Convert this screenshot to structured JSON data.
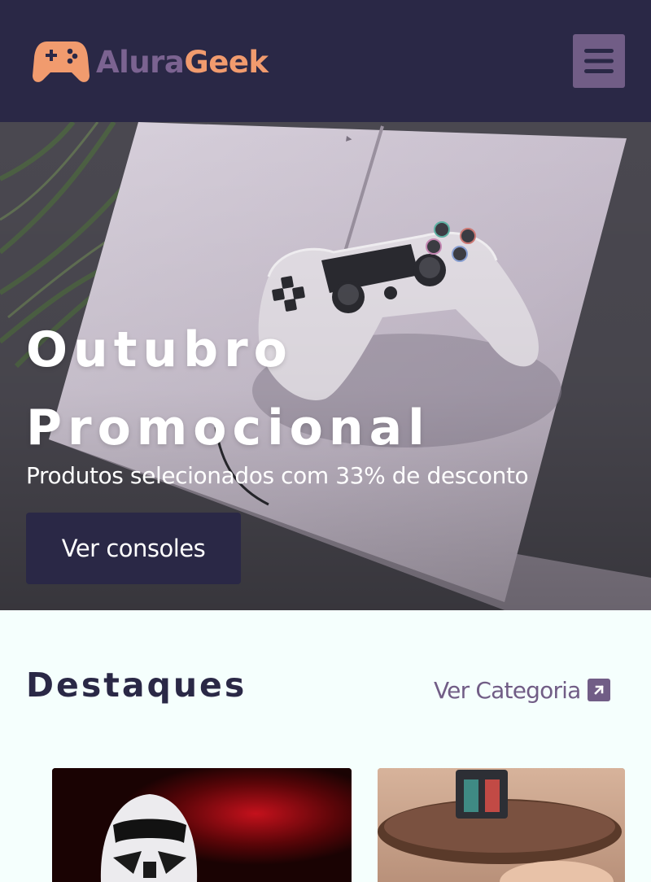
{
  "header": {
    "logo": {
      "part1": "Alura",
      "part2": "Geek"
    },
    "menu_icon": "hamburger-icon"
  },
  "hero": {
    "title_line1": "Outubro",
    "title_line2": "Promocional",
    "subtitle": "Produtos selecionados com 33% de desconto",
    "cta_label": "Ver consoles"
  },
  "featured": {
    "title": "Destaques",
    "link_label": "Ver Categoria",
    "link_icon": "arrow-up-right-icon",
    "products": [
      {
        "image": "stormtrooper-figure-image"
      },
      {
        "image": "mug-image"
      }
    ]
  },
  "colors": {
    "header_bg": "#2A2846",
    "accent_purple": "#715D86",
    "accent_orange": "#F19B6E",
    "page_bg": "#F5FFFD"
  }
}
